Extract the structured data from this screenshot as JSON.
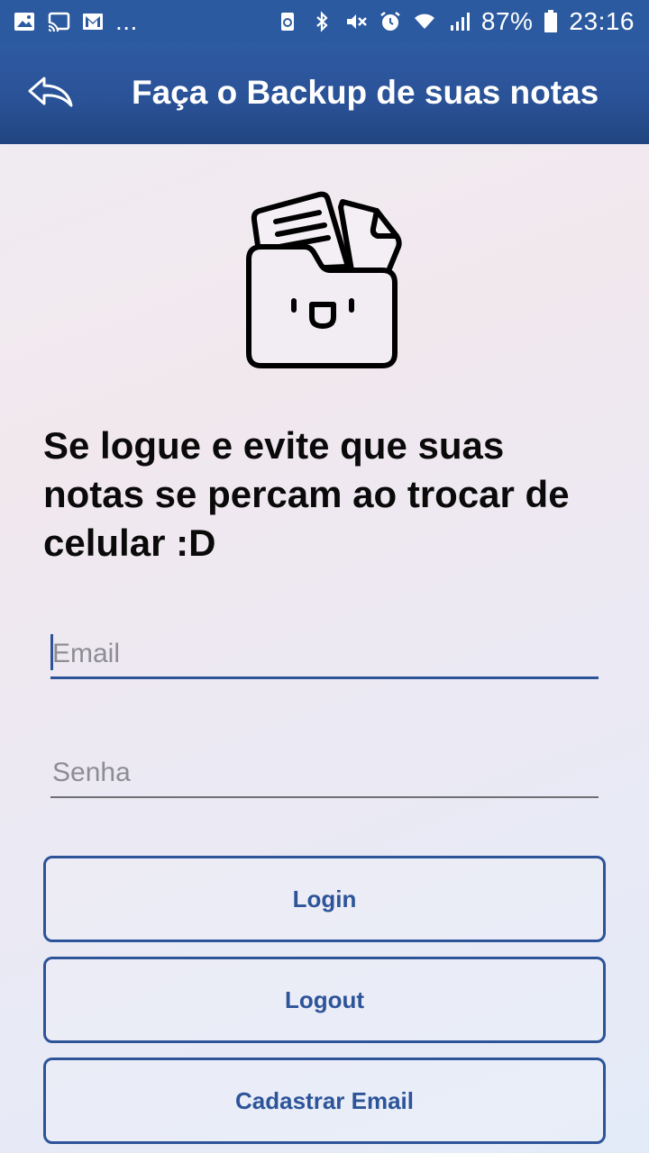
{
  "status_bar": {
    "overflow": "...",
    "battery": "87%",
    "time": "23:16",
    "left_icons": [
      "gallery-icon",
      "cast-icon",
      "gmail-icon"
    ],
    "right_icons": [
      "recycle-icon",
      "bluetooth-icon",
      "mute-icon",
      "alarm-icon",
      "wifi-icon",
      "signal-icon",
      "battery-icon"
    ]
  },
  "app_bar": {
    "title": "Faça o Backup de suas notas",
    "back_icon": "back-arrow-icon"
  },
  "illustration": {
    "icon": "folder-with-notes-icon"
  },
  "headline": "Se logue e evite que suas notas se percam ao trocar de celular :D",
  "form": {
    "email_placeholder": "Email",
    "email_value": "",
    "password_placeholder": "Senha",
    "password_value": ""
  },
  "buttons": {
    "login": "Login",
    "logout": "Logout",
    "register": "Cadastrar Email"
  },
  "colors": {
    "primary": "#2c5aa0",
    "accent": "#2d5499",
    "text": "#0a0a0a"
  }
}
